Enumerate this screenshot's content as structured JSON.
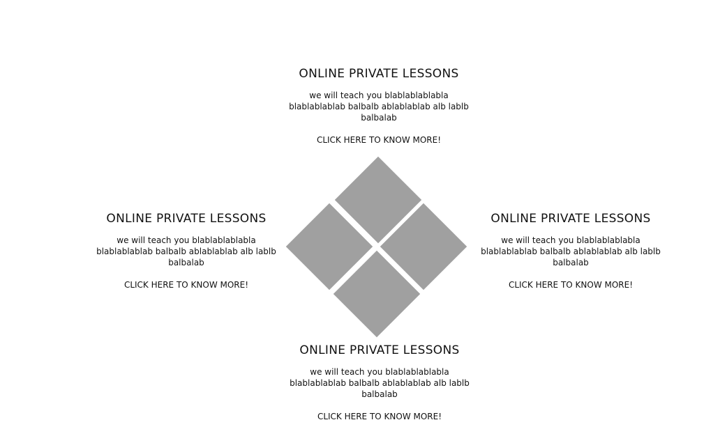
{
  "colors": {
    "tile": "#a0a0a0",
    "text": "#111111",
    "background": "#ffffff"
  },
  "blocks": {
    "top": {
      "title": "ONLINE PRIVATE LESSONS",
      "description": "we will teach you blablablablabla blablablablab balbalb ablablablab alb lablb balbalab",
      "link": "CLICK HERE TO KNOW MORE!"
    },
    "left": {
      "title": "ONLINE PRIVATE LESSONS",
      "description": "we will teach you blablablablabla blablablablab balbalb ablablablab alb lablb balbalab",
      "link": "CLICK HERE TO KNOW MORE!"
    },
    "right": {
      "title": "ONLINE PRIVATE LESSONS",
      "description": "we will teach you blablablablabla blablablablab balbalb ablablablab alb lablb balbalab",
      "link": "CLICK HERE TO KNOW MORE!"
    },
    "bottom": {
      "title": "ONLINE PRIVATE LESSONS",
      "description": "we will teach you blablablablabla blablablablab balbalb ablablablab alb lablb balbalab",
      "link": "CLICK HERE TO KNOW MORE!"
    }
  }
}
